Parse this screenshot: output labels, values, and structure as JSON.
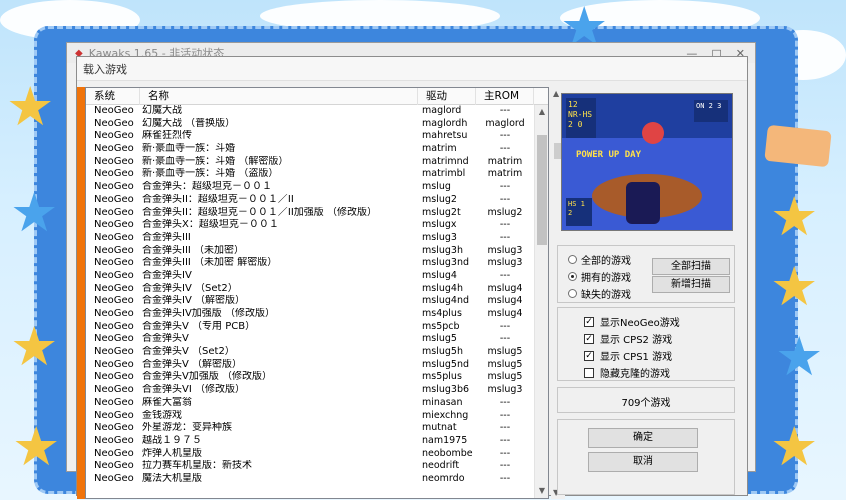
{
  "back_window": {
    "title": "Kawaks 1.65 - 非活动状态",
    "controls": [
      "—",
      "□",
      "✕"
    ]
  },
  "dialog": {
    "title": "载入游戏",
    "columns": [
      "系统",
      "名称",
      "驱动",
      "主ROM"
    ],
    "games": [
      {
        "sys": "NeoGeo",
        "name": "幻魔大战",
        "drv": "maglord",
        "rom": "---"
      },
      {
        "sys": "NeoGeo",
        "name": "幻魔大战 （普换版）",
        "drv": "maglordh",
        "rom": "maglord"
      },
      {
        "sys": "NeoGeo",
        "name": "麻雀狂烈传",
        "drv": "mahretsu",
        "rom": "---"
      },
      {
        "sys": "NeoGeo",
        "name": "新·豪血寺一族：斗婚",
        "drv": "matrim",
        "rom": "---"
      },
      {
        "sys": "NeoGeo",
        "name": "新·豪血寺一族：斗婚 （解密版）",
        "drv": "matrimnd",
        "rom": "matrim"
      },
      {
        "sys": "NeoGeo",
        "name": "新·豪血寺一族：斗婚 （盗版）",
        "drv": "matrimbl",
        "rom": "matrim"
      },
      {
        "sys": "NeoGeo",
        "name": "合金弹头：超级坦克－００１",
        "drv": "mslug",
        "rom": "---"
      },
      {
        "sys": "NeoGeo",
        "name": "合金弹头II：超级坦克－００１／II",
        "drv": "mslug2",
        "rom": "---"
      },
      {
        "sys": "NeoGeo",
        "name": "合金弹头II：超级坦克－００１／II加强版 （修改版）",
        "drv": "mslug2t",
        "rom": "mslug2"
      },
      {
        "sys": "NeoGeo",
        "name": "合金弹头X：超级坦克－００１",
        "drv": "mslugx",
        "rom": "---"
      },
      {
        "sys": "NeoGeo",
        "name": "合金弹头III",
        "drv": "mslug3",
        "rom": "---"
      },
      {
        "sys": "NeoGeo",
        "name": "合金弹头III （未加密）",
        "drv": "mslug3h",
        "rom": "mslug3"
      },
      {
        "sys": "NeoGeo",
        "name": "合金弹头III （未加密 解密版）",
        "drv": "mslug3nd",
        "rom": "mslug3"
      },
      {
        "sys": "NeoGeo",
        "name": "合金弹头IV",
        "drv": "mslug4",
        "rom": "---"
      },
      {
        "sys": "NeoGeo",
        "name": "合金弹头IV （Set2）",
        "drv": "mslug4h",
        "rom": "mslug4"
      },
      {
        "sys": "NeoGeo",
        "name": "合金弹头IV （解密版）",
        "drv": "mslug4nd",
        "rom": "mslug4"
      },
      {
        "sys": "NeoGeo",
        "name": "合金弹头IV加强版 （修改版）",
        "drv": "ms4plus",
        "rom": "mslug4"
      },
      {
        "sys": "NeoGeo",
        "name": "合金弹头V （专用 PCB）",
        "drv": "ms5pcb",
        "rom": "---"
      },
      {
        "sys": "NeoGeo",
        "name": "合金弹头V",
        "drv": "mslug5",
        "rom": "---"
      },
      {
        "sys": "NeoGeo",
        "name": "合金弹头V （Set2）",
        "drv": "mslug5h",
        "rom": "mslug5"
      },
      {
        "sys": "NeoGeo",
        "name": "合金弹头V （解密版）",
        "drv": "mslug5nd",
        "rom": "mslug5"
      },
      {
        "sys": "NeoGeo",
        "name": "合金弹头V加强版 （修改版）",
        "drv": "ms5plus",
        "rom": "mslug5"
      },
      {
        "sys": "NeoGeo",
        "name": "合金弹头VI （修改版）",
        "drv": "mslug3b6",
        "rom": "mslug3"
      },
      {
        "sys": "NeoGeo",
        "name": "麻雀大富翁",
        "drv": "minasan",
        "rom": "---"
      },
      {
        "sys": "NeoGeo",
        "name": "金钱游戏",
        "drv": "miexchng",
        "rom": "---"
      },
      {
        "sys": "NeoGeo",
        "name": "外星游龙：变异种族",
        "drv": "mutnat",
        "rom": "---"
      },
      {
        "sys": "NeoGeo",
        "name": "越战１９７５",
        "drv": "nam1975",
        "rom": "---"
      },
      {
        "sys": "NeoGeo",
        "name": "炸弹人机皇版",
        "drv": "neobombe",
        "rom": "---"
      },
      {
        "sys": "NeoGeo",
        "name": "拉力赛车机皇版：新技术",
        "drv": "neodrift",
        "rom": "---"
      },
      {
        "sys": "NeoGeo",
        "name": "魔法大机皇版",
        "drv": "neomrdo",
        "rom": "---"
      }
    ],
    "preview": {
      "score_left": "12 NR-HS 2 0",
      "score_right": "ON 2 3",
      "caption": "POWER UP DAY",
      "score_bottom": "HS 1 2"
    },
    "filter_options": [
      {
        "label": "全部的游戏",
        "selected": false
      },
      {
        "label": "拥有的游戏",
        "selected": true
      },
      {
        "label": "缺失的游戏",
        "selected": false
      }
    ],
    "scan_all_label": "全部扫描",
    "scan_new_label": "新增扫描",
    "checkboxes": [
      {
        "label": "显示NeoGeo游戏",
        "checked": true
      },
      {
        "label": "显示 CPS2 游戏",
        "checked": true
      },
      {
        "label": "显示 CPS1 游戏",
        "checked": true
      },
      {
        "label": "隐藏克隆的游戏",
        "checked": false
      }
    ],
    "count_label": "709个游戏",
    "ok_label": "确定",
    "cancel_label": "取消"
  }
}
